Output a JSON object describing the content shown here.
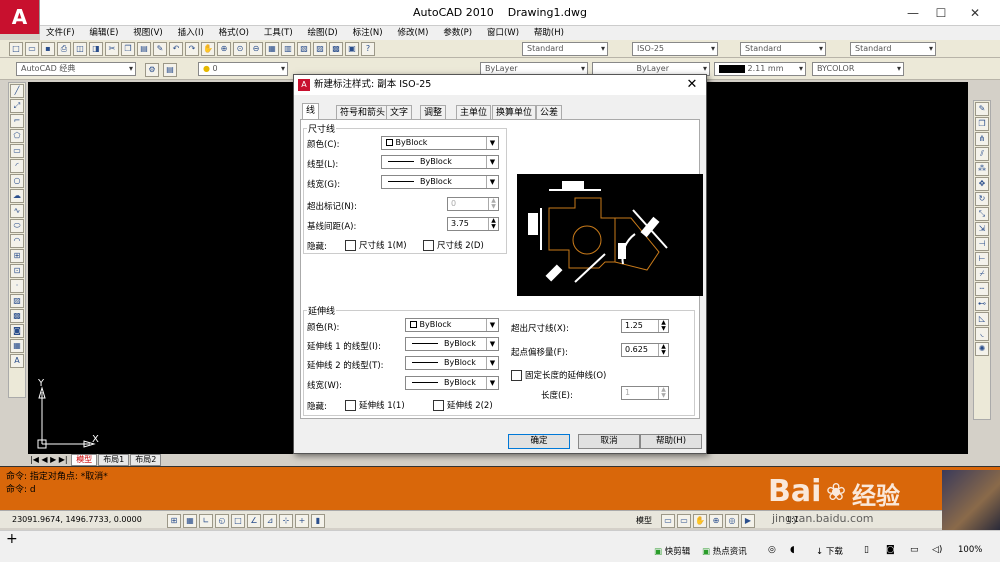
{
  "title_bar": {
    "app_name": "AutoCAD 2010",
    "document": "Drawing1.dwg"
  },
  "menu": [
    "文件(F)",
    "编辑(E)",
    "视图(V)",
    "插入(I)",
    "格式(O)",
    "工具(T)",
    "绘图(D)",
    "标注(N)",
    "修改(M)",
    "参数(P)",
    "窗口(W)",
    "帮助(H)"
  ],
  "toolbar": {
    "text_style": "Standard",
    "dim_style": "ISO-25",
    "table_style": "Standard",
    "multileader_style": "Standard",
    "workspace": "AutoCAD 经典",
    "layer": "0",
    "color": "ByLayer",
    "linetype": "ByLayer",
    "lineweight": "2.11 mm",
    "plot_style": "BYCOLOR"
  },
  "drawing": {
    "ucs_y": "Y",
    "ucs_x": "X"
  },
  "layout_tabs": [
    "模型",
    "布局1",
    "布局2"
  ],
  "command": {
    "line1": "命令: 指定对角点: *取消*",
    "line2": "命令: d"
  },
  "status": {
    "coordinates": "23091.9674, 1496.7733, 0.0000",
    "model": "模型",
    "scale": "1:1"
  },
  "taskbar": {
    "quick_edit": "快剪辑",
    "hot_news": "热点资讯",
    "download": "下载",
    "zoom": "100%"
  },
  "watermark": {
    "brand": "Bai",
    "brand2": "经验",
    "url": "jingyan.baidu.com"
  },
  "dialog": {
    "title": "新建标注样式: 副本 ISO-25",
    "tabs": [
      "线",
      "符号和箭头",
      "文字",
      "调整",
      "主单位",
      "换算单位",
      "公差"
    ],
    "dim_lines": {
      "group": "尺寸线",
      "color_label": "颜色(C):",
      "color_value": "ByBlock",
      "linetype_label": "线型(L):",
      "linetype_value": "ByBlock",
      "lineweight_label": "线宽(G):",
      "lineweight_value": "ByBlock",
      "extend_label": "超出标记(N):",
      "extend_value": "0",
      "baseline_label": "基线间距(A):",
      "baseline_value": "3.75",
      "suppress_label": "隐藏:",
      "suppress1": "尺寸线 1(M)",
      "suppress2": "尺寸线 2(D)"
    },
    "ext_lines": {
      "group": "延伸线",
      "color_label": "颜色(R):",
      "color_value": "ByBlock",
      "lt1_label": "延伸线 1 的线型(I):",
      "lt1_value": "ByBlock",
      "lt2_label": "延伸线 2 的线型(T):",
      "lt2_value": "ByBlock",
      "lw_label": "线宽(W):",
      "lw_value": "ByBlock",
      "suppress_label": "隐藏:",
      "suppress1": "延伸线 1(1)",
      "suppress2": "延伸线 2(2)",
      "extend_label": "超出尺寸线(X):",
      "extend_value": "1.25",
      "offset_label": "起点偏移量(F):",
      "offset_value": "0.625",
      "fixed_label": "固定长度的延伸线(O)",
      "length_label": "长度(E):",
      "length_value": "1"
    },
    "buttons": {
      "ok": "确定",
      "cancel": "取消",
      "help": "帮助(H)"
    }
  }
}
